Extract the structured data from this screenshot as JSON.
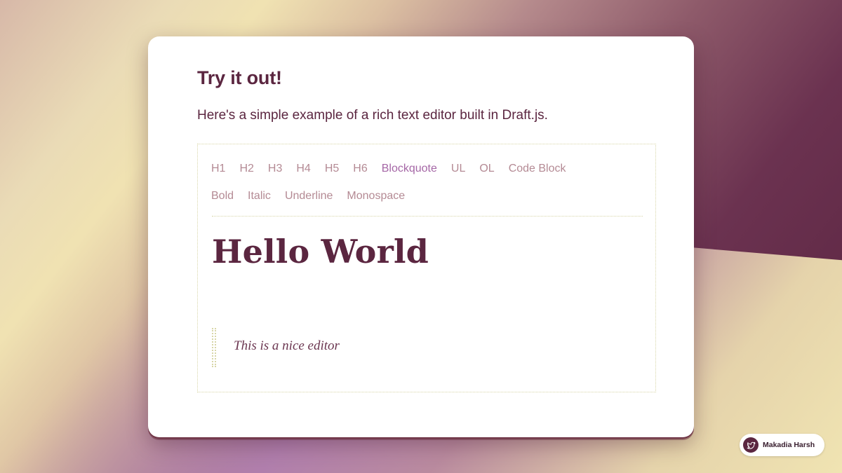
{
  "card": {
    "title": "Try it out!",
    "description": "Here's a simple example of a rich text editor built in Draft.js."
  },
  "toolbar": {
    "block_types": [
      {
        "label": "H1",
        "active": false
      },
      {
        "label": "H2",
        "active": false
      },
      {
        "label": "H3",
        "active": false
      },
      {
        "label": "H4",
        "active": false
      },
      {
        "label": "H5",
        "active": false
      },
      {
        "label": "H6",
        "active": false
      },
      {
        "label": "Blockquote",
        "active": true
      },
      {
        "label": "UL",
        "active": false
      },
      {
        "label": "OL",
        "active": false
      },
      {
        "label": "Code Block",
        "active": false
      }
    ],
    "inline_styles": [
      {
        "label": "Bold",
        "active": false
      },
      {
        "label": "Italic",
        "active": false
      },
      {
        "label": "Underline",
        "active": false
      },
      {
        "label": "Monospace",
        "active": false
      }
    ]
  },
  "editor": {
    "heading_text": "Hello World",
    "blockquote_text": "This is a nice editor"
  },
  "author_badge": {
    "name": "Makadia Harsh",
    "icon": "bird-icon"
  },
  "colors": {
    "primary": "#5b2640",
    "toolbar_text": "#b48a94",
    "toolbar_active": "#a567a6",
    "border": "#d8d6a8"
  }
}
